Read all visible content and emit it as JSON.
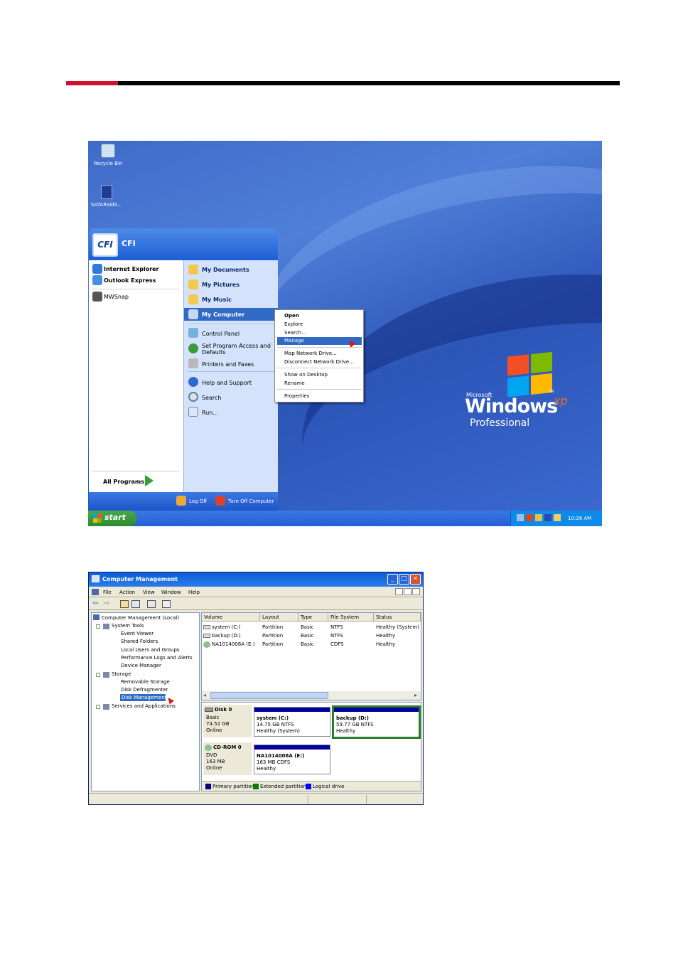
{
  "desktop": {
    "icons": [
      {
        "label": "Recycle Bin"
      },
      {
        "label": "SATARaidS..."
      }
    ],
    "start_menu": {
      "user": "CFI",
      "logo": "CFI",
      "left_items": [
        "Internet Explorer",
        "Outlook Express",
        "MWSnap"
      ],
      "all_programs": "All Programs",
      "right_items": [
        "My Documents",
        "My Pictures",
        "My Music",
        "My Computer",
        "Control Panel",
        "Set Program Access and Defaults",
        "Printers and Faxes",
        "Help and Support",
        "Search",
        "Run..."
      ],
      "log_off": "Log Off",
      "turn_off": "Turn Off Computer"
    },
    "context_menu": [
      "Open",
      "Explore",
      "Search...",
      "Manage",
      "Map Network Drive...",
      "Disconnect Network Drive...",
      "Show on Desktop",
      "Rename",
      "Properties"
    ],
    "logo": {
      "brand": "Microsoft",
      "product": "Windows",
      "xp": "xp",
      "edition": "Professional",
      "tm": "TM"
    },
    "taskbar": {
      "start": "start",
      "clock": "10:26 AM"
    }
  },
  "computer_management": {
    "title": "Computer Management",
    "menu": [
      "File",
      "Action",
      "View",
      "Window",
      "Help"
    ],
    "tree": [
      "Computer Management (Local)",
      "System Tools",
      "Event Viewer",
      "Shared Folders",
      "Local Users and Groups",
      "Performance Logs and Alerts",
      "Device Manager",
      "Storage",
      "Removable Storage",
      "Disk Defragmenter",
      "Disk Management",
      "Services and Applications"
    ],
    "columns": [
      "Volume",
      "Layout",
      "Type",
      "File System",
      "Status"
    ],
    "rows": [
      [
        "system (C:)",
        "Partition",
        "Basic",
        "NTFS",
        "Healthy (System)"
      ],
      [
        "backup (D:)",
        "Partition",
        "Basic",
        "NTFS",
        "Healthy"
      ],
      [
        "NA1014008A (E:)",
        "Partition",
        "Basic",
        "CDFS",
        "Healthy"
      ]
    ],
    "disks": [
      {
        "name": "Disk 0",
        "type": "Basic",
        "size": "74.52 GB",
        "state": "Online"
      },
      {
        "name": "CD-ROM 0",
        "type": "DVD",
        "size": "163 MB",
        "state": "Online"
      }
    ],
    "partitions": [
      {
        "name": "system  (C:)",
        "size": "14.75 GB NTFS",
        "status": "Healthy (System)"
      },
      {
        "name": "backup  (D:)",
        "size": "59.77 GB NTFS",
        "status": "Healthy"
      },
      {
        "name": "NA1014008A  (E:)",
        "size": "163 MB CDFS",
        "status": "Healthy"
      }
    ],
    "legend": [
      "Primary partition",
      "Extended partition",
      "Logical drive"
    ],
    "colors": {
      "primary": "#000080",
      "extended": "#008000",
      "logical": "#0000ff"
    }
  }
}
